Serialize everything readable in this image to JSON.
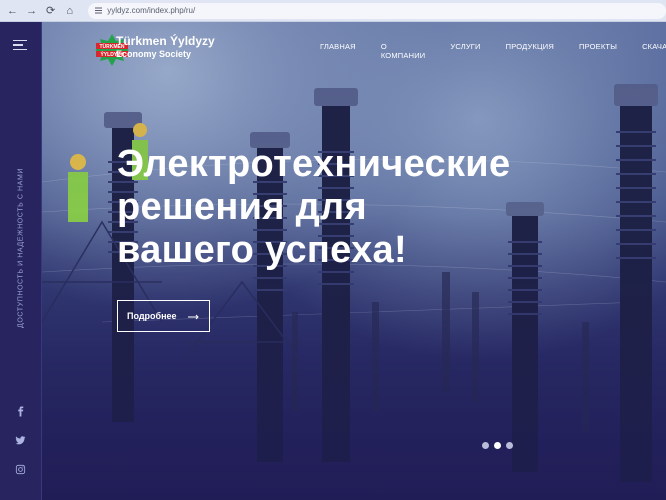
{
  "browser": {
    "url": "yyldyz.com/index.php/ru/"
  },
  "sidebar": {
    "vertical_text": "Доступность и надежность с нами",
    "social": [
      "facebook-icon",
      "twitter-icon",
      "instagram-icon"
    ]
  },
  "header": {
    "brand_name": "Türkmen Ýyldyzy",
    "brand_sub": "Economy Society",
    "logo_text_top": "TÜRKMEN",
    "logo_text_bottom": "ÝYLDYZY",
    "nav": [
      "ГЛАВНАЯ",
      "О КОМПАНИИ",
      "УСЛУГИ",
      "ПРОДУКЦИЯ",
      "ПРОЕКТЫ",
      "СКАЧАТЬ"
    ]
  },
  "hero": {
    "headline_line1": "Электротехнические",
    "headline_line2": "решения для",
    "headline_line3": "вашего успеха!",
    "button_label": "Подробнее",
    "slides_count": 3,
    "active_slide": 2
  },
  "colors": {
    "sidebar": "#28245f",
    "logo_green": "#22a34a",
    "logo_red": "#d8262e"
  }
}
